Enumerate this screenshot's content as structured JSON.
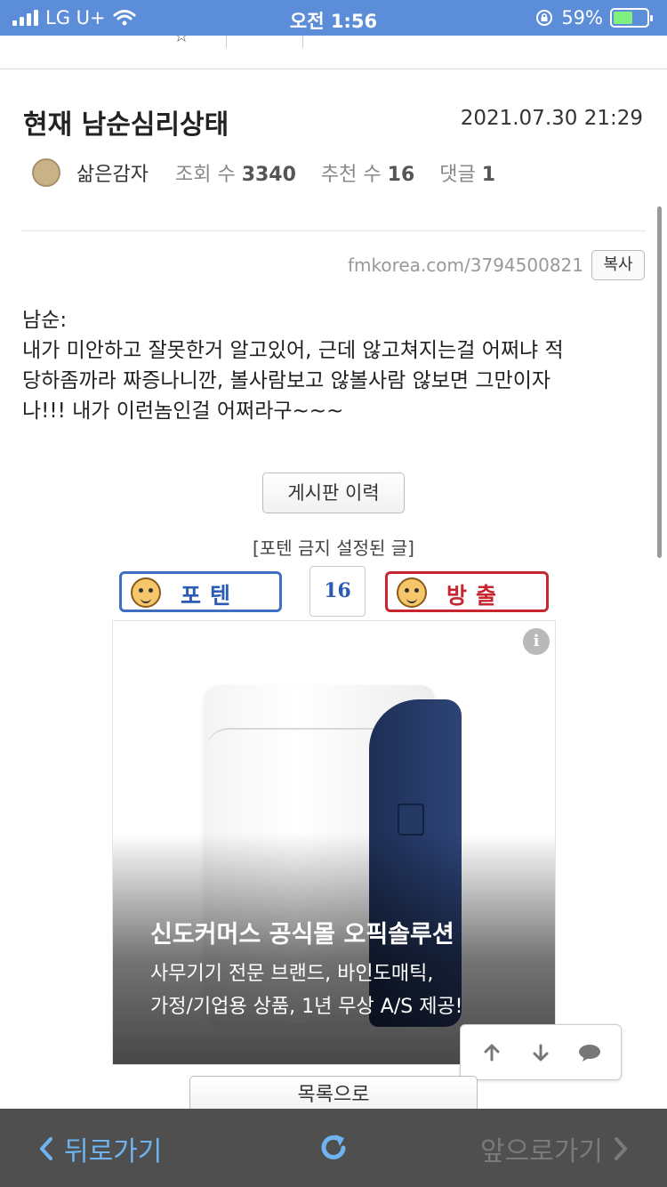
{
  "status_bar": {
    "carrier": "LG U+",
    "time": "오전 1:56",
    "battery_percent": "59%",
    "battery_level": 0.59
  },
  "top_nav": {
    "items": [
      "",
      "",
      "",
      ""
    ]
  },
  "post": {
    "title": "현재 남순심리상태",
    "date": "2021.07.30 21:29",
    "author": "삶은감자",
    "views_label": "조회 수",
    "views": "3340",
    "recommend_label": "추천 수",
    "recommend": "16",
    "comments_label": "댓글",
    "comments": "1",
    "short_url": "fmkorea.com/3794500821",
    "copy_label": "복사",
    "body_lines": [
      "남순:",
      "내가 미안하고 잘못한거 알고있어, 근데 않고쳐지는걸 어쩌냐 적",
      "당하좀까라 짜증나니깐, 볼사람보고 않볼사람 않보면 그만이자",
      "나!!!  내가 이런놈인걸 어쩌라구~~~"
    ],
    "history_button": "게시판 이력",
    "notice": "[포텐 금지 설정된 글]"
  },
  "vote": {
    "up_label": "포텐",
    "count": "16",
    "down_label": "방출"
  },
  "ad": {
    "info": "i",
    "title": "신도커머스 공식몰 오픽솔루션",
    "desc_line1": "사무기기 전문 브랜드, 바인도매틱,",
    "desc_line2": "가정/기업용 상품, 1년 무상 A/S 제공!"
  },
  "list_button": "목록으로",
  "bottom_bar": {
    "back_label": "뒤로가기",
    "forward_label": "앞으로가기"
  },
  "colors": {
    "status_bar": "#5b8dd9",
    "vote_up": "#3f6fc0",
    "vote_down": "#c8262e",
    "bottom_bar": "#4f4f4f",
    "back_active": "#6fb3f0"
  }
}
